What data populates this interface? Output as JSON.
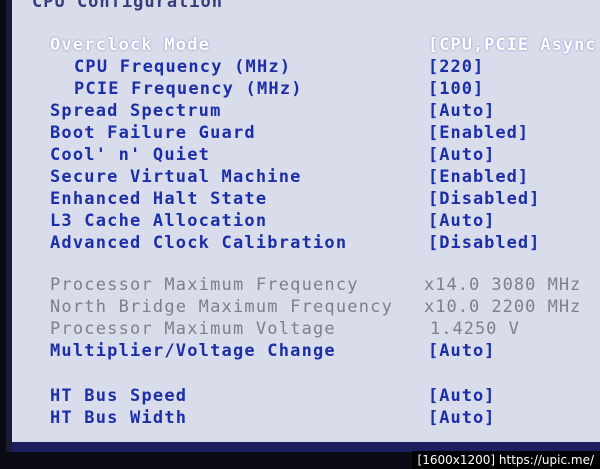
{
  "section_title": "CPU Configuration",
  "items": [
    {
      "label": "Overclock Mode",
      "value": "[CPU,PCIE Async",
      "kind": "highlight"
    },
    {
      "label": "CPU Frequency (MHz)",
      "value": "[220]",
      "kind": "sub"
    },
    {
      "label": "PCIE Frequency (MHz)",
      "value": "[100]",
      "kind": "sub"
    },
    {
      "label": "Spread Spectrum",
      "value": "[Auto]",
      "kind": "main"
    },
    {
      "label": "Boot Failure Guard",
      "value": "[Enabled]",
      "kind": "main"
    },
    {
      "label": "Cool' n' Quiet",
      "value": "[Auto]",
      "kind": "main"
    },
    {
      "label": "Secure Virtual Machine",
      "value": "[Enabled]",
      "kind": "main"
    },
    {
      "label": "Enhanced Halt State",
      "value": "[Disabled]",
      "kind": "main"
    },
    {
      "label": "L3 Cache Allocation",
      "value": "[Auto]",
      "kind": "main"
    },
    {
      "label": "Advanced Clock Calibration",
      "value": "[Disabled]",
      "kind": "main"
    },
    {
      "label": "Processor Maximum Frequency",
      "value": "x14.0 3080 MHz",
      "kind": "info"
    },
    {
      "label": "North Bridge Maximum Frequency",
      "value": "x10.0 2200 MHz",
      "kind": "info"
    },
    {
      "label": "Processor Maximum Voltage",
      "value": "1.4250 V",
      "kind": "info"
    },
    {
      "label": "Multiplier/Voltage Change",
      "value": "[Auto]",
      "kind": "main"
    },
    {
      "label": "HT Bus Speed",
      "value": "[Auto]",
      "kind": "main"
    },
    {
      "label": "HT Bus Width",
      "value": "[Auto]",
      "kind": "main"
    }
  ],
  "footer": {
    "resolution": "[1600x1200]",
    "url": "https://upic.me/"
  },
  "colors": {
    "option_text": "#1c2fa8",
    "selected_text": "#ffffff",
    "info_text": "#7d7f8e",
    "background": "#d9dcea"
  }
}
